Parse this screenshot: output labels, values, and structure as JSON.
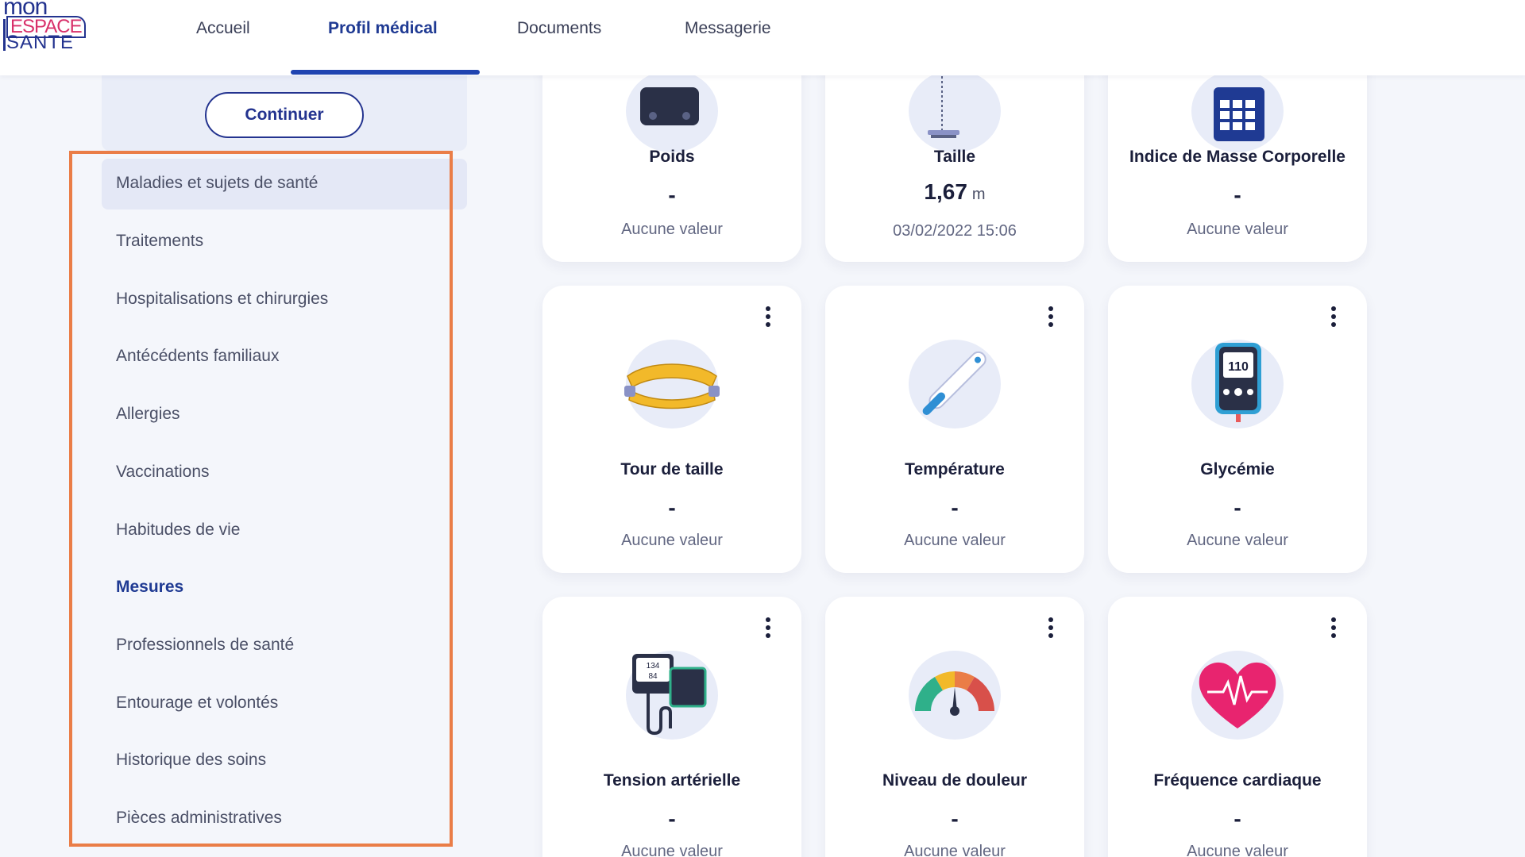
{
  "logo": {
    "line1": "mon",
    "line2": "ESPACE",
    "line3": "SANTE"
  },
  "nav": [
    {
      "label": "Accueil"
    },
    {
      "label": "Profil médical"
    },
    {
      "label": "Documents"
    },
    {
      "label": "Messagerie"
    }
  ],
  "sidebar": {
    "continue_label": "Continuer",
    "items": [
      {
        "label": "Maladies et sujets de santé"
      },
      {
        "label": "Traitements"
      },
      {
        "label": "Hospitalisations et chirurgies"
      },
      {
        "label": "Antécédents familiaux"
      },
      {
        "label": "Allergies"
      },
      {
        "label": "Vaccinations"
      },
      {
        "label": "Habitudes de vie"
      },
      {
        "label": "Mesures"
      },
      {
        "label": "Professionnels de santé"
      },
      {
        "label": "Entourage et volontés"
      },
      {
        "label": "Historique des soins"
      },
      {
        "label": "Pièces administratives"
      }
    ]
  },
  "cards": [
    {
      "title": "Poids",
      "value": "-",
      "unit": "",
      "sub": "Aucune valeur",
      "icon": "scale-icon"
    },
    {
      "title": "Taille",
      "value": "1,67",
      "unit": "m",
      "sub": "03/02/2022 15:06",
      "icon": "height-gauge-icon"
    },
    {
      "title": "Indice de Masse Corporelle",
      "value": "-",
      "unit": "",
      "sub": "Aucune valeur",
      "icon": "calculator-icon"
    },
    {
      "title": "Tour de taille",
      "value": "-",
      "unit": "",
      "sub": "Aucune valeur",
      "icon": "tape-measure-icon"
    },
    {
      "title": "Température",
      "value": "-",
      "unit": "",
      "sub": "Aucune valeur",
      "icon": "thermometer-icon"
    },
    {
      "title": "Glycémie",
      "value": "-",
      "unit": "",
      "sub": "Aucune valeur",
      "icon": "glucometer-icon",
      "reading": "110"
    },
    {
      "title": "Tension artérielle",
      "value": "-",
      "unit": "",
      "sub": "Aucune valeur",
      "icon": "blood-pressure-monitor-icon",
      "reading_top": "134",
      "reading_bottom": "84"
    },
    {
      "title": "Niveau de douleur",
      "value": "-",
      "unit": "",
      "sub": "Aucune valeur",
      "icon": "pain-gauge-icon"
    },
    {
      "title": "Fréquence cardiaque",
      "value": "-",
      "unit": "",
      "sub": "Aucune valeur",
      "icon": "heart-rate-icon"
    }
  ],
  "colors": {
    "brand": "#23338f",
    "accent": "#1f43b0",
    "highlight": "#ea7d47",
    "heart": "#e8246f"
  }
}
